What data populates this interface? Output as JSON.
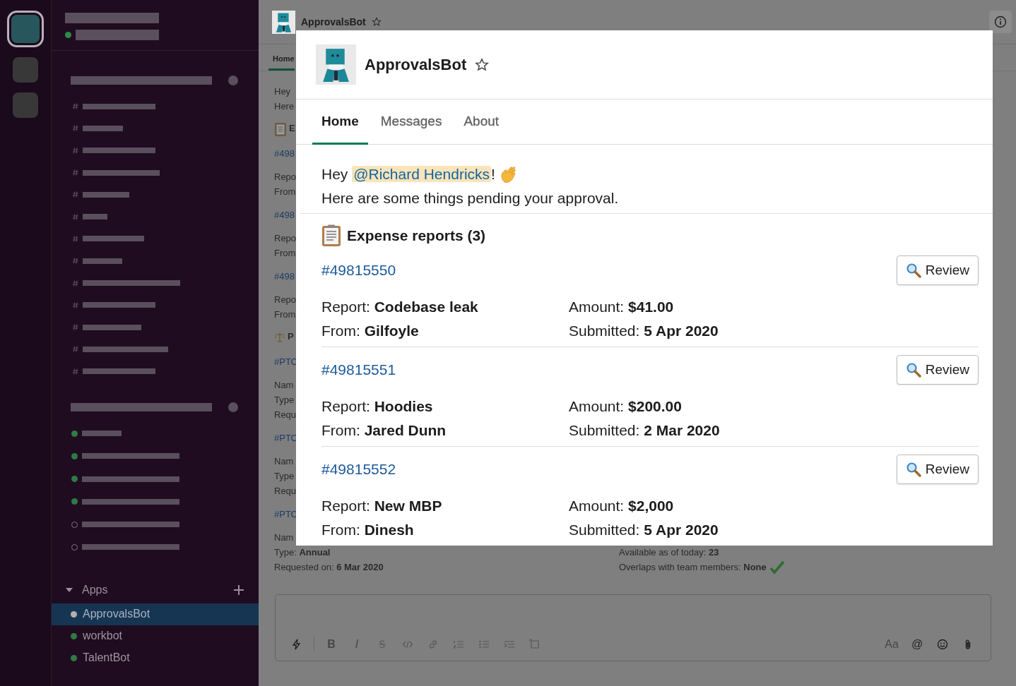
{
  "workspace_rail": [
    {
      "selected": true
    },
    {
      "selected": false
    },
    {
      "selected": false
    }
  ],
  "sidebar": {
    "header": {
      "online": true
    },
    "channels": [
      {
        "redacted": true
      },
      {
        "redacted": true
      },
      {
        "redacted": true
      },
      {
        "redacted": true
      },
      {
        "redacted": true
      },
      {
        "redacted": true
      },
      {
        "redacted": true
      },
      {
        "redacted": true
      },
      {
        "redacted": true
      },
      {
        "redacted": true
      },
      {
        "redacted": true
      },
      {
        "redacted": true
      },
      {
        "redacted": true
      }
    ],
    "direct_messages": [
      {
        "online": true
      },
      {
        "online": true
      },
      {
        "online": true
      },
      {
        "online": true
      },
      {
        "online": false
      },
      {
        "online": false
      }
    ],
    "apps_header": "Apps",
    "apps": [
      {
        "name": "ApprovalsBot",
        "selected": true
      },
      {
        "name": "workbot",
        "selected": false
      },
      {
        "name": "TalentBot",
        "selected": false
      }
    ]
  },
  "channel_header": {
    "title": "ApprovalsBot",
    "starred": false
  },
  "channel_tabs": [
    {
      "label": "Home",
      "selected": true
    }
  ],
  "feed": [
    {
      "kind": "text_lines",
      "lines": [
        "Hey",
        "Here"
      ]
    },
    {
      "kind": "expense_heading",
      "text": "E"
    },
    {
      "kind": "record",
      "id": "#498",
      "lines": [
        "Repo",
        "From"
      ]
    },
    {
      "kind": "record",
      "id": "#498",
      "lines": [
        "Repo",
        "From"
      ]
    },
    {
      "kind": "record",
      "id": "#498",
      "lines": [
        "Repo",
        "From"
      ]
    },
    {
      "kind": "pto_heading",
      "text": "P"
    },
    {
      "kind": "record",
      "id": "#PTO",
      "lines": [
        "Nam",
        "Type",
        "Requ"
      ]
    },
    {
      "kind": "record",
      "id": "#PTO",
      "lines": [
        "Nam",
        "Type",
        "Requ"
      ]
    },
    {
      "kind": "record",
      "id": "#PTO",
      "lines": [
        "Nam"
      ],
      "details": [
        {
          "left": "Type: **Annual**",
          "right": "Available as of today: **23**",
          "confirmed": false
        },
        {
          "left": "Requested on: **6 Mar 2020**",
          "right": "Overlaps with team members: **None**",
          "confirmed": true
        }
      ]
    }
  ],
  "composer": {
    "buttons": [
      {
        "kind": "shortcut",
        "disabled": false
      },
      {
        "kind": "bold",
        "label": "B",
        "disabled": true
      },
      {
        "kind": "italic",
        "label": "I",
        "disabled": true
      },
      {
        "kind": "strike",
        "disabled": true
      },
      {
        "kind": "code",
        "disabled": true
      },
      {
        "kind": "link",
        "disabled": true
      },
      {
        "kind": "ordered_list",
        "disabled": true
      },
      {
        "kind": "bullet_list",
        "disabled": true
      },
      {
        "kind": "indent",
        "disabled": true
      },
      {
        "kind": "block",
        "disabled": true
      }
    ],
    "right_buttons": [
      {
        "kind": "text_format",
        "label": "Aa",
        "disabled": true
      },
      {
        "kind": "mention",
        "label": "@",
        "disabled": false
      },
      {
        "kind": "emoji",
        "disabled": false
      },
      {
        "kind": "attach",
        "disabled": false
      }
    ]
  },
  "app_home": {
    "name": "ApprovalsBot",
    "starred": false,
    "tabs": [
      {
        "label": "Home",
        "selected": true
      },
      {
        "label": "Messages",
        "selected": false
      },
      {
        "label": "About",
        "selected": false
      }
    ],
    "greeting": {
      "before": "Hey ",
      "mention": "@Richard Hendricks",
      "after": "!"
    },
    "intro": "Here are some things pending your approval.",
    "section_title": "Expense reports (3)",
    "reports": [
      {
        "id": "#49815550",
        "button": "Review",
        "fields": [
          "Report: **Codebase leak**",
          "Amount: **$41.00**",
          "From: **Gilfoyle**",
          "Submitted: **5 Apr 2020**"
        ]
      },
      {
        "id": "#49815551",
        "button": "Review",
        "fields": [
          "Report: **Hoodies**",
          "Amount: **$200.00**",
          "From: **Jared Dunn**",
          "Submitted: **2 Mar 2020**"
        ]
      },
      {
        "id": "#49815552",
        "button": "Review",
        "fields": [
          "Report: **New MBP**",
          "Amount: **$2,000**",
          "From: **Dinesh**",
          "Submitted: **5 Apr 2020**"
        ]
      }
    ]
  }
}
